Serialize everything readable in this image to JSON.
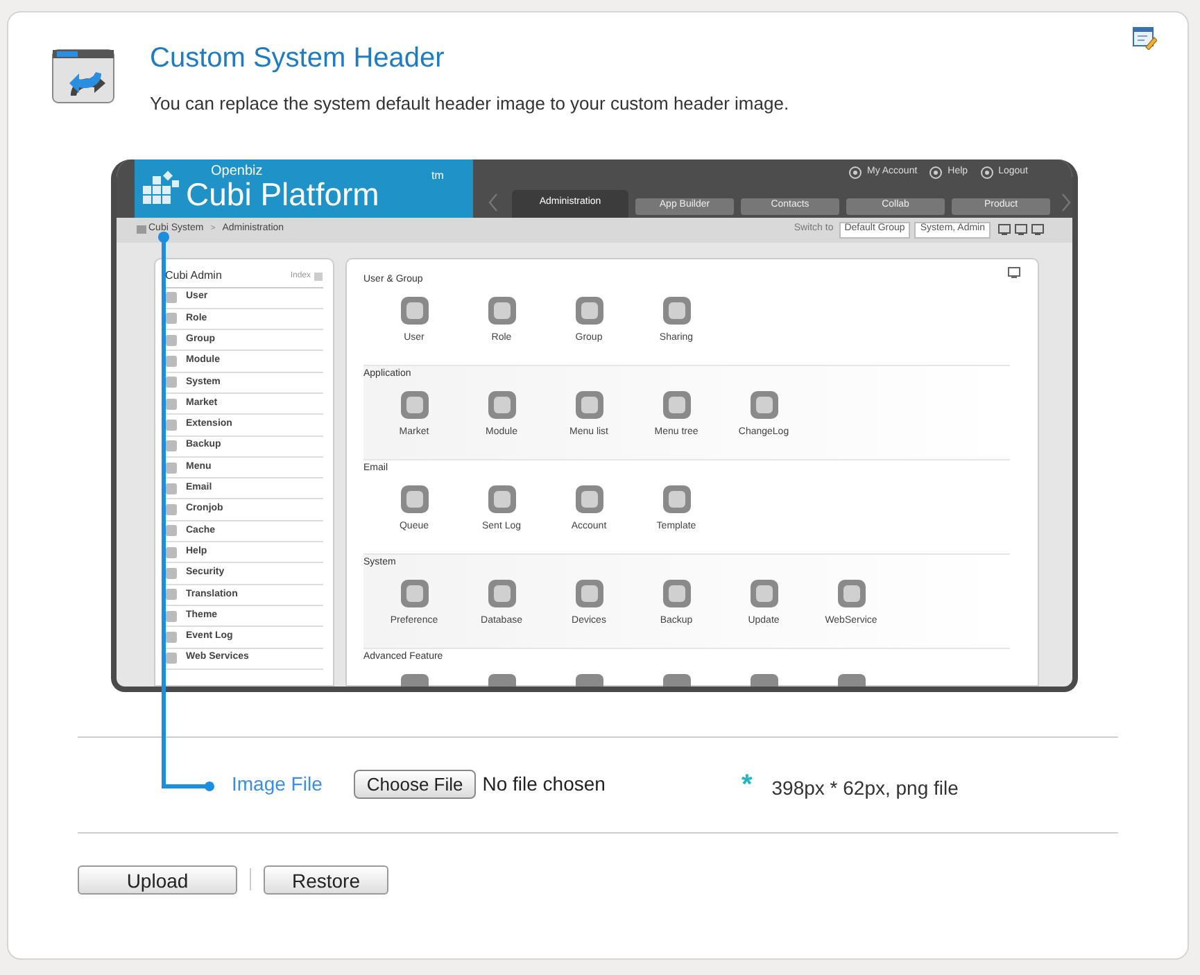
{
  "page": {
    "title": "Custom System Header",
    "description": "You can replace the system default header image to your custom header image."
  },
  "preview": {
    "brand_small": "Openbiz",
    "brand": "Cubi Platform",
    "trademark": "tm",
    "user_links": [
      "My Account",
      "Help",
      "Logout"
    ],
    "tabs": [
      {
        "label": "Administration",
        "selected": true
      },
      {
        "label": "App Builder",
        "selected": false
      },
      {
        "label": "Contacts",
        "selected": false
      },
      {
        "label": "Collab",
        "selected": false
      },
      {
        "label": "Product",
        "selected": false
      }
    ],
    "breadcrumb": [
      "Cubi System",
      "Administration"
    ],
    "breadcrumb_separator": ">",
    "switch_label": "Switch to",
    "switch_fields": [
      "Default Group",
      "System, Admin"
    ],
    "sidebar": {
      "title": "Cubi Admin",
      "index_label": "Index",
      "items": [
        "User",
        "Role",
        "Group",
        "Module",
        "System",
        "Market",
        "Extension",
        "Backup",
        "Menu",
        "Email",
        "Cronjob",
        "Cache",
        "Help",
        "Security",
        "Translation",
        "Theme",
        "Event Log",
        "Web Services"
      ]
    },
    "sections": [
      {
        "title": "User & Group",
        "items": [
          "User",
          "Role",
          "Group",
          "Sharing"
        ]
      },
      {
        "title": "Application",
        "items": [
          "Market",
          "Module",
          "Menu list",
          "Menu tree",
          "ChangeLog"
        ]
      },
      {
        "title": "Email",
        "items": [
          "Queue",
          "Sent Log",
          "Account",
          "Template"
        ]
      },
      {
        "title": "System",
        "items": [
          "Preference",
          "Database",
          "Devices",
          "Backup",
          "Update",
          "WebService"
        ]
      },
      {
        "title": "Advanced Feature"
      }
    ]
  },
  "form": {
    "label": "Image File",
    "choose_button": "Choose File",
    "file_status": "No file chosen",
    "hint_mark": "*",
    "hint": "398px * 62px, png file"
  },
  "buttons": [
    "Upload",
    "Restore"
  ]
}
